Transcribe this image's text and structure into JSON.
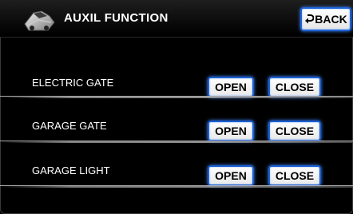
{
  "header": {
    "title": "AUXIL FUNCTION",
    "logo_icon": "car-icon",
    "back_label": "BACK",
    "back_icon": "return-arrow-icon"
  },
  "rows": [
    {
      "label": "ELECTRIC GATE",
      "open_label": "OPEN",
      "close_label": "CLOSE"
    },
    {
      "label": "GARAGE GATE",
      "open_label": "OPEN",
      "close_label": "CLOSE"
    },
    {
      "label": "GARAGE LIGHT",
      "open_label": "OPEN",
      "close_label": "CLOSE"
    }
  ],
  "colors": {
    "background": "#000000",
    "button_border": "#1c5fd2",
    "button_glow": "#3f86ff",
    "text": "#ffffff"
  }
}
